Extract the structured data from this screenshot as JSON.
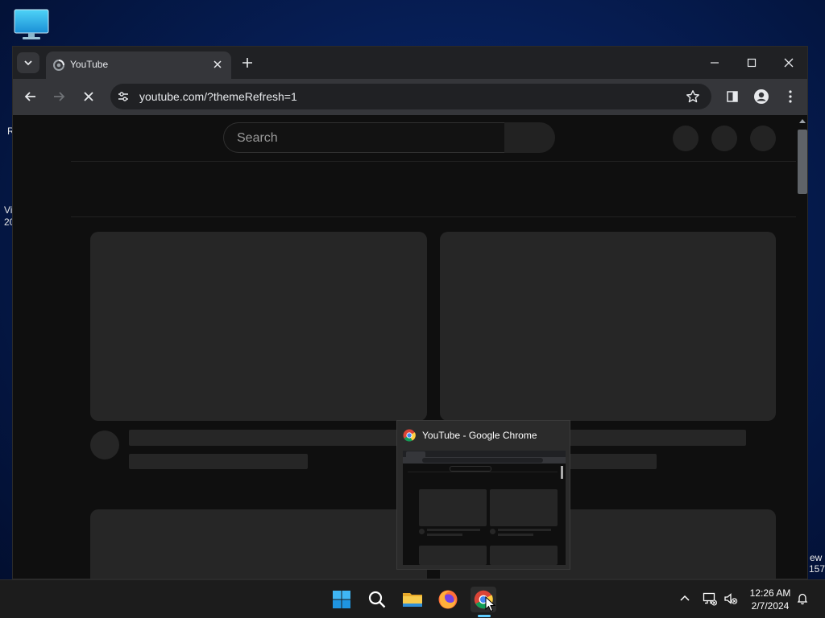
{
  "desktop": {
    "icon": "this-pc-monitor-icon",
    "fragments": [
      "R",
      "Vi",
      "20",
      "ew",
      "157"
    ]
  },
  "browser": {
    "tab_title": "YouTube",
    "url": "youtube.com/?themeRefresh=1",
    "icons": {
      "tab_dropdown": "chevron-down-icon",
      "new_tab": "plus-icon",
      "minimize": "minimize-icon",
      "maximize": "maximize-icon",
      "close": "close-icon",
      "back": "back-arrow-icon",
      "forward": "forward-arrow-icon",
      "stop": "stop-loading-icon",
      "site_info": "tune-icon",
      "bookmark": "star-icon",
      "side_panel": "side-panel-icon",
      "profile": "profile-icon",
      "menu": "kebab-menu-icon"
    }
  },
  "youtube": {
    "search_placeholder": "Search",
    "loading_placeholders": true
  },
  "preview": {
    "title": "YouTube - Google Chrome"
  },
  "taskbar": {
    "apps": [
      "start-icon",
      "search-icon",
      "file-explorer-icon",
      "firefox-icon",
      "chrome-icon"
    ],
    "active_app": "chrome-icon",
    "time": "12:26 AM",
    "date": "2/7/2024",
    "tray_icons": [
      "chevron-up-icon",
      "network-icon",
      "volume-muted-icon",
      "notification-bell-icon"
    ]
  },
  "colors": {
    "accent": "#60cdff",
    "chrome_dark": "#202124",
    "chrome_toolbar": "#35363a",
    "yt_background": "#0f0f0f",
    "placeholder": "#262626"
  }
}
